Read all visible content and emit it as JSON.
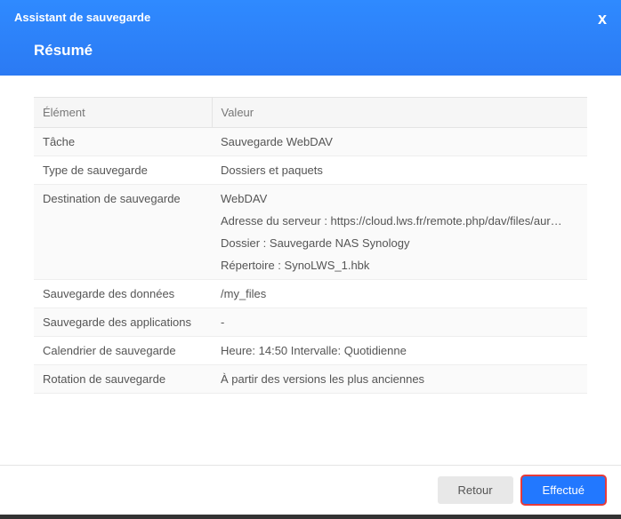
{
  "header": {
    "title": "Assistant de sauvegarde",
    "subtitle": "Résumé"
  },
  "table": {
    "col_element": "Élément",
    "col_value": "Valeur",
    "rows": {
      "task": {
        "label": "Tâche",
        "value": "Sauvegarde WebDAV"
      },
      "type": {
        "label": "Type de sauvegarde",
        "value": "Dossiers et paquets"
      },
      "dest": {
        "label": "Destination de sauvegarde",
        "line1": "WebDAV",
        "line2": "Adresse du serveur : https://cloud.lws.fr/remote.php/dav/files/aur…",
        "line3": "Dossier : Sauvegarde NAS Synology",
        "line4": "Répertoire : SynoLWS_1.hbk"
      },
      "data": {
        "label": "Sauvegarde des données",
        "value": "/my_files"
      },
      "apps": {
        "label": "Sauvegarde des applications",
        "value": "-"
      },
      "schedule": {
        "label": "Calendrier de sauvegarde",
        "value": "Heure: 14:50 Intervalle: Quotidienne"
      },
      "rotation": {
        "label": "Rotation de sauvegarde",
        "value": "À partir des versions les plus anciennes"
      }
    }
  },
  "footer": {
    "back": "Retour",
    "done": "Effectué"
  }
}
